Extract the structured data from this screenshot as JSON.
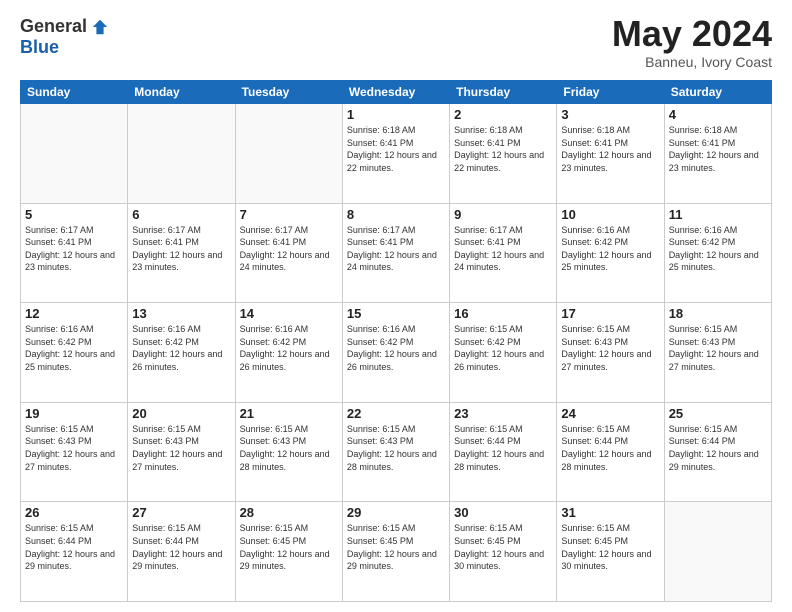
{
  "header": {
    "logo_general": "General",
    "logo_blue": "Blue",
    "month": "May 2024",
    "location": "Banneu, Ivory Coast"
  },
  "days_of_week": [
    "Sunday",
    "Monday",
    "Tuesday",
    "Wednesday",
    "Thursday",
    "Friday",
    "Saturday"
  ],
  "weeks": [
    [
      {
        "day": "",
        "info": ""
      },
      {
        "day": "",
        "info": ""
      },
      {
        "day": "",
        "info": ""
      },
      {
        "day": "1",
        "info": "Sunrise: 6:18 AM\nSunset: 6:41 PM\nDaylight: 12 hours\nand 22 minutes."
      },
      {
        "day": "2",
        "info": "Sunrise: 6:18 AM\nSunset: 6:41 PM\nDaylight: 12 hours\nand 22 minutes."
      },
      {
        "day": "3",
        "info": "Sunrise: 6:18 AM\nSunset: 6:41 PM\nDaylight: 12 hours\nand 23 minutes."
      },
      {
        "day": "4",
        "info": "Sunrise: 6:18 AM\nSunset: 6:41 PM\nDaylight: 12 hours\nand 23 minutes."
      }
    ],
    [
      {
        "day": "5",
        "info": "Sunrise: 6:17 AM\nSunset: 6:41 PM\nDaylight: 12 hours\nand 23 minutes."
      },
      {
        "day": "6",
        "info": "Sunrise: 6:17 AM\nSunset: 6:41 PM\nDaylight: 12 hours\nand 23 minutes."
      },
      {
        "day": "7",
        "info": "Sunrise: 6:17 AM\nSunset: 6:41 PM\nDaylight: 12 hours\nand 24 minutes."
      },
      {
        "day": "8",
        "info": "Sunrise: 6:17 AM\nSunset: 6:41 PM\nDaylight: 12 hours\nand 24 minutes."
      },
      {
        "day": "9",
        "info": "Sunrise: 6:17 AM\nSunset: 6:41 PM\nDaylight: 12 hours\nand 24 minutes."
      },
      {
        "day": "10",
        "info": "Sunrise: 6:16 AM\nSunset: 6:42 PM\nDaylight: 12 hours\nand 25 minutes."
      },
      {
        "day": "11",
        "info": "Sunrise: 6:16 AM\nSunset: 6:42 PM\nDaylight: 12 hours\nand 25 minutes."
      }
    ],
    [
      {
        "day": "12",
        "info": "Sunrise: 6:16 AM\nSunset: 6:42 PM\nDaylight: 12 hours\nand 25 minutes."
      },
      {
        "day": "13",
        "info": "Sunrise: 6:16 AM\nSunset: 6:42 PM\nDaylight: 12 hours\nand 26 minutes."
      },
      {
        "day": "14",
        "info": "Sunrise: 6:16 AM\nSunset: 6:42 PM\nDaylight: 12 hours\nand 26 minutes."
      },
      {
        "day": "15",
        "info": "Sunrise: 6:16 AM\nSunset: 6:42 PM\nDaylight: 12 hours\nand 26 minutes."
      },
      {
        "day": "16",
        "info": "Sunrise: 6:15 AM\nSunset: 6:42 PM\nDaylight: 12 hours\nand 26 minutes."
      },
      {
        "day": "17",
        "info": "Sunrise: 6:15 AM\nSunset: 6:43 PM\nDaylight: 12 hours\nand 27 minutes."
      },
      {
        "day": "18",
        "info": "Sunrise: 6:15 AM\nSunset: 6:43 PM\nDaylight: 12 hours\nand 27 minutes."
      }
    ],
    [
      {
        "day": "19",
        "info": "Sunrise: 6:15 AM\nSunset: 6:43 PM\nDaylight: 12 hours\nand 27 minutes."
      },
      {
        "day": "20",
        "info": "Sunrise: 6:15 AM\nSunset: 6:43 PM\nDaylight: 12 hours\nand 27 minutes."
      },
      {
        "day": "21",
        "info": "Sunrise: 6:15 AM\nSunset: 6:43 PM\nDaylight: 12 hours\nand 28 minutes."
      },
      {
        "day": "22",
        "info": "Sunrise: 6:15 AM\nSunset: 6:43 PM\nDaylight: 12 hours\nand 28 minutes."
      },
      {
        "day": "23",
        "info": "Sunrise: 6:15 AM\nSunset: 6:44 PM\nDaylight: 12 hours\nand 28 minutes."
      },
      {
        "day": "24",
        "info": "Sunrise: 6:15 AM\nSunset: 6:44 PM\nDaylight: 12 hours\nand 28 minutes."
      },
      {
        "day": "25",
        "info": "Sunrise: 6:15 AM\nSunset: 6:44 PM\nDaylight: 12 hours\nand 29 minutes."
      }
    ],
    [
      {
        "day": "26",
        "info": "Sunrise: 6:15 AM\nSunset: 6:44 PM\nDaylight: 12 hours\nand 29 minutes."
      },
      {
        "day": "27",
        "info": "Sunrise: 6:15 AM\nSunset: 6:44 PM\nDaylight: 12 hours\nand 29 minutes."
      },
      {
        "day": "28",
        "info": "Sunrise: 6:15 AM\nSunset: 6:45 PM\nDaylight: 12 hours\nand 29 minutes."
      },
      {
        "day": "29",
        "info": "Sunrise: 6:15 AM\nSunset: 6:45 PM\nDaylight: 12 hours\nand 29 minutes."
      },
      {
        "day": "30",
        "info": "Sunrise: 6:15 AM\nSunset: 6:45 PM\nDaylight: 12 hours\nand 30 minutes."
      },
      {
        "day": "31",
        "info": "Sunrise: 6:15 AM\nSunset: 6:45 PM\nDaylight: 12 hours\nand 30 minutes."
      },
      {
        "day": "",
        "info": ""
      }
    ]
  ]
}
